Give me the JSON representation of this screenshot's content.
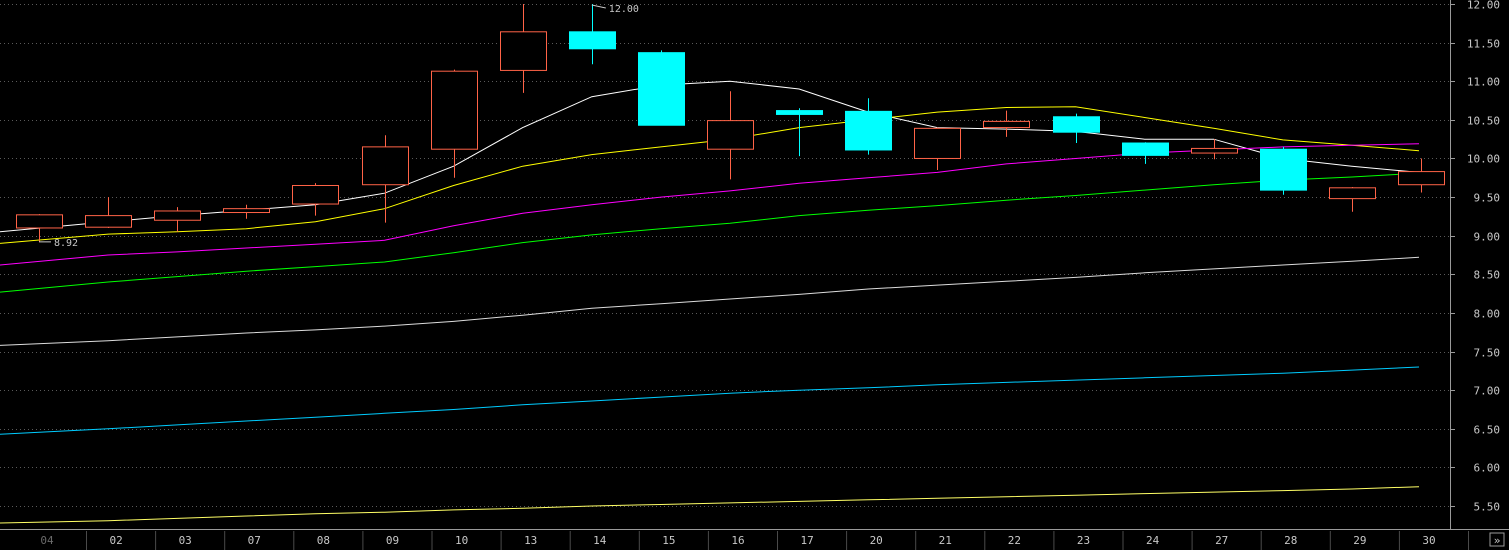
{
  "chart_data": {
    "type": "candlestick",
    "y_range": [
      5.3,
      12.0
    ],
    "y_ticks": [
      {
        "value": 12.0,
        "label": "12.00"
      },
      {
        "value": 11.5,
        "label": "11.50"
      },
      {
        "value": 11.0,
        "label": "11.00"
      },
      {
        "value": 10.5,
        "label": "10.50"
      },
      {
        "value": 10.0,
        "label": "10.00"
      },
      {
        "value": 9.5,
        "label": "9.50"
      },
      {
        "value": 9.0,
        "label": "9.00"
      },
      {
        "value": 8.5,
        "label": "8.50"
      },
      {
        "value": 8.0,
        "label": "8.00"
      },
      {
        "value": 7.5,
        "label": "7.50"
      },
      {
        "value": 7.0,
        "label": "7.00"
      },
      {
        "value": 6.5,
        "label": "6.50"
      },
      {
        "value": 6.0,
        "label": "6.00"
      },
      {
        "value": 5.5,
        "label": "5.50"
      }
    ],
    "grid": "dotted horizontal",
    "categories": [
      "04",
      "02",
      "03",
      "07",
      "08",
      "09",
      "10",
      "13",
      "14",
      "15",
      "16",
      "17",
      "20",
      "21",
      "22",
      "23",
      "24",
      "27",
      "28",
      "29",
      "30"
    ],
    "first_label_dimmed": true,
    "candles": [
      {
        "open": 9.1,
        "high": 9.28,
        "low": 8.92,
        "close": 9.27
      },
      {
        "open": 9.11,
        "high": 9.5,
        "low": 9.1,
        "close": 9.26
      },
      {
        "open": 9.2,
        "high": 9.37,
        "low": 9.05,
        "close": 9.32
      },
      {
        "open": 9.3,
        "high": 9.4,
        "low": 9.22,
        "close": 9.35
      },
      {
        "open": 9.41,
        "high": 9.68,
        "low": 9.26,
        "close": 9.65
      },
      {
        "open": 9.66,
        "high": 10.3,
        "low": 9.17,
        "close": 10.15
      },
      {
        "open": 10.12,
        "high": 11.15,
        "low": 9.75,
        "close": 11.13
      },
      {
        "open": 11.14,
        "high": 12.0,
        "low": 10.85,
        "close": 11.64
      },
      {
        "open": 11.64,
        "high": 12.0,
        "low": 11.22,
        "close": 11.42
      },
      {
        "open": 11.37,
        "high": 11.4,
        "low": 10.43,
        "close": 10.43
      },
      {
        "open": 10.12,
        "high": 10.87,
        "low": 9.73,
        "close": 10.49
      },
      {
        "open": 10.62,
        "high": 10.65,
        "low": 10.03,
        "close": 10.57
      },
      {
        "open": 10.61,
        "high": 10.78,
        "low": 10.05,
        "close": 10.11
      },
      {
        "open": 10.0,
        "high": 10.4,
        "low": 9.85,
        "close": 10.39
      },
      {
        "open": 10.4,
        "high": 10.62,
        "low": 10.28,
        "close": 10.48
      },
      {
        "open": 10.54,
        "high": 10.58,
        "low": 10.2,
        "close": 10.34
      },
      {
        "open": 10.2,
        "high": 10.21,
        "low": 9.93,
        "close": 10.04
      },
      {
        "open": 10.07,
        "high": 10.25,
        "low": 9.99,
        "close": 10.13
      },
      {
        "open": 10.12,
        "high": 10.15,
        "low": 9.53,
        "close": 9.59
      },
      {
        "open": 9.48,
        "high": 9.63,
        "low": 9.31,
        "close": 9.62
      },
      {
        "open": 9.66,
        "high": 10.0,
        "low": 9.56,
        "close": 9.83
      }
    ],
    "up_color": "#ff6347",
    "down_color": "#00ffff",
    "moving_averages": [
      {
        "color": "#ffffff",
        "values": [
          9.05,
          9.18,
          9.26,
          9.33,
          9.4,
          9.55,
          9.9,
          10.4,
          10.8,
          10.95,
          11.0,
          10.9,
          10.6,
          10.4,
          10.38,
          10.35,
          10.25,
          10.25,
          10.0,
          9.9,
          9.82
        ]
      },
      {
        "color": "#ffff00",
        "values": [
          8.9,
          9.02,
          9.05,
          9.09,
          9.18,
          9.35,
          9.65,
          9.9,
          10.05,
          10.15,
          10.25,
          10.4,
          10.5,
          10.6,
          10.66,
          10.67,
          10.53,
          10.39,
          10.24,
          10.17,
          10.1
        ]
      },
      {
        "color": "#ff00ff",
        "values": [
          8.62,
          8.75,
          8.79,
          8.84,
          8.89,
          8.94,
          9.13,
          9.29,
          9.4,
          9.5,
          9.58,
          9.68,
          9.75,
          9.82,
          9.93,
          10.0,
          10.07,
          10.11,
          10.15,
          10.17,
          10.19
        ]
      },
      {
        "color": "#00ff00",
        "values": [
          8.27,
          8.4,
          8.47,
          8.54,
          8.6,
          8.66,
          8.78,
          8.91,
          9.01,
          9.09,
          9.16,
          9.26,
          9.33,
          9.39,
          9.46,
          9.52,
          9.59,
          9.66,
          9.72,
          9.76,
          9.81
        ]
      },
      {
        "color": "#dcdcdc",
        "values": [
          7.58,
          7.64,
          7.69,
          7.74,
          7.78,
          7.83,
          7.89,
          7.97,
          8.06,
          8.12,
          8.18,
          8.24,
          8.31,
          8.36,
          8.41,
          8.46,
          8.52,
          8.57,
          8.62,
          8.67,
          8.72
        ]
      },
      {
        "color": "#00ccff",
        "values": [
          6.43,
          6.5,
          6.55,
          6.6,
          6.65,
          6.7,
          6.75,
          6.81,
          6.86,
          6.91,
          6.96,
          7.0,
          7.03,
          7.07,
          7.1,
          7.13,
          7.16,
          7.19,
          7.22,
          7.26,
          7.3
        ]
      },
      {
        "color": "#ffff66",
        "values": [
          5.28,
          5.31,
          5.34,
          5.37,
          5.4,
          5.42,
          5.45,
          5.47,
          5.5,
          5.52,
          5.54,
          5.56,
          5.58,
          5.6,
          5.62,
          5.64,
          5.66,
          5.68,
          5.7,
          5.72,
          5.75
        ]
      }
    ],
    "annotations": [
      {
        "label": "8.92",
        "value": 8.92,
        "candle_index": 0
      },
      {
        "label": "12.00",
        "value": 12.0,
        "candle_index": 8
      }
    ]
  },
  "nav": {
    "expand_button_label": "»"
  }
}
